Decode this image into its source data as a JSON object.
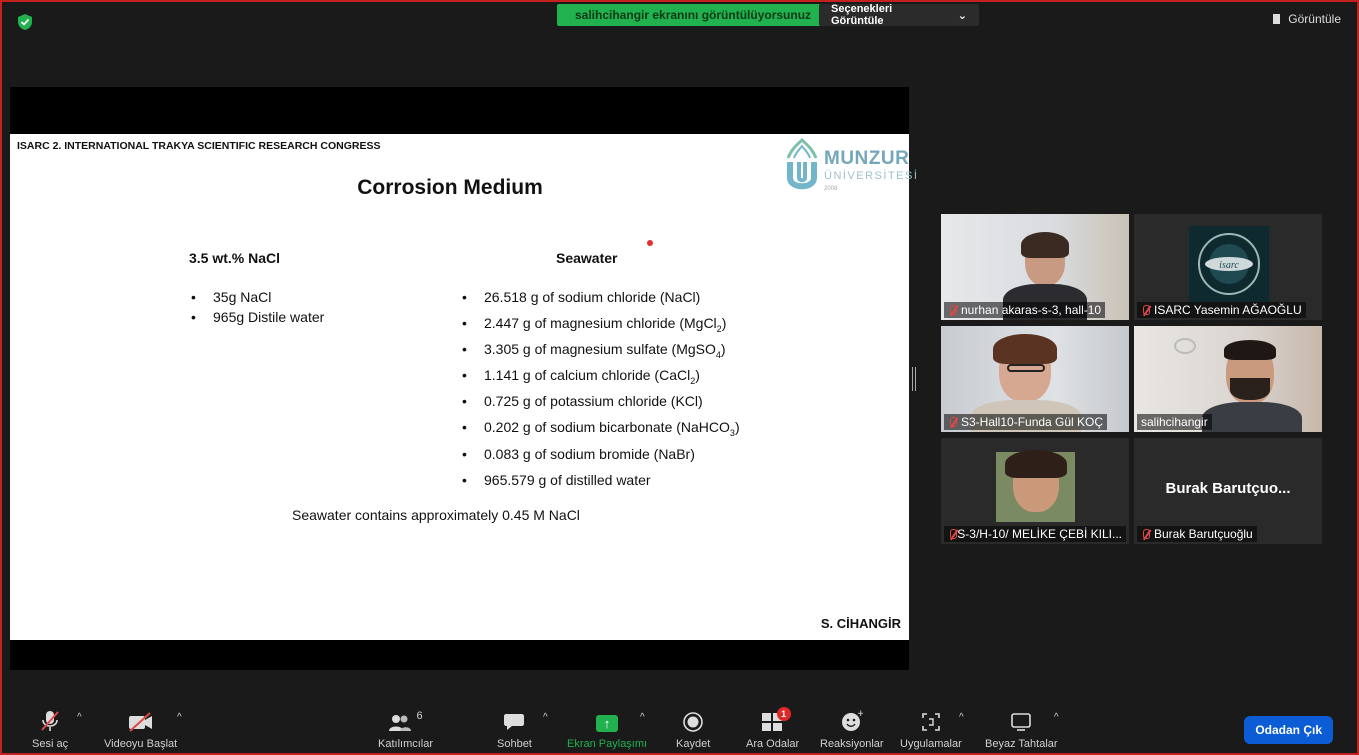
{
  "banner": {
    "sharing_text": "salihcihangir ekranını görüntülüyorsunuz",
    "options_label": "Seçenekleri Görüntüle",
    "view_label": "Görüntüle"
  },
  "slide": {
    "header": "ISARC 2. INTERNATIONAL TRAKYA SCIENTIFIC RESEARCH CONGRESS",
    "title": "Corrosion Medium",
    "logo": {
      "name": "MUNZUR",
      "sub": "ÜNİVERSİTESİ",
      "year": "2008"
    },
    "left_title": "3.5 wt.% NaCl",
    "left_items": [
      "35g NaCl",
      "965g Distile water"
    ],
    "right_title": "Seawater",
    "right_items": [
      {
        "text": "26.518 g of sodium chloride (NaCl)",
        "sub": "",
        "tail": ""
      },
      {
        "text": "2.447 g of magnesium chloride (MgCl",
        "sub": "2",
        "tail": ")"
      },
      {
        "text": "3.305 g of magnesium sulfate (MgSO",
        "sub": "4",
        "tail": ")"
      },
      {
        "text": "1.141 g of calcium chloride (CaCl",
        "sub": "2",
        "tail": ")"
      },
      {
        "text": "0.725 g of potassium chloride (KCl)",
        "sub": "",
        "tail": ""
      },
      {
        "text": "0.202 g of sodium bicarbonate (NaHCO",
        "sub": "3",
        "tail": ")"
      },
      {
        "text": "0.083 g of sodium bromide (NaBr)",
        "sub": "",
        "tail": ""
      },
      {
        "text": "965.579 g of distilled water",
        "sub": "",
        "tail": ""
      }
    ],
    "note": "Seawater contains approximately 0.45 M NaCl",
    "signature": "S. CİHANGİR"
  },
  "participants": [
    {
      "label": "nurhan akaras-s-3, hall-10",
      "muted": true
    },
    {
      "label": "ISARC Yasemin AĞAOĞLU",
      "muted": true
    },
    {
      "label": "S3-Hall10-Funda Gül KOÇ",
      "muted": true
    },
    {
      "label": "salihcihangir",
      "muted": false,
      "active": true
    },
    {
      "label": "S-3/H-10/ MELİKE ÇEBİ KILI...",
      "muted": true
    },
    {
      "label": "Burak Barutçuoğlu",
      "muted": true,
      "center_name": "Burak  Barutçuo..."
    }
  ],
  "toolbar": {
    "audio": "Sesi aç",
    "video": "Videoyu Başlat",
    "participants": "Katılımcılar",
    "participant_count": "6",
    "chat": "Sohbet",
    "share": "Ekran Paylaşımı",
    "record": "Kaydet",
    "breakout": "Ara Odalar",
    "breakout_badge": "1",
    "reactions": "Reaksiyonlar",
    "apps": "Uygulamalar",
    "whiteboard": "Beyaz Tahtalar",
    "leave": "Odadan Çık"
  },
  "colors": {
    "share_green": "#21b14e",
    "leave_blue": "#0b5cd5",
    "active_speaker": "#c8e05a",
    "muted_red": "#e04848"
  }
}
